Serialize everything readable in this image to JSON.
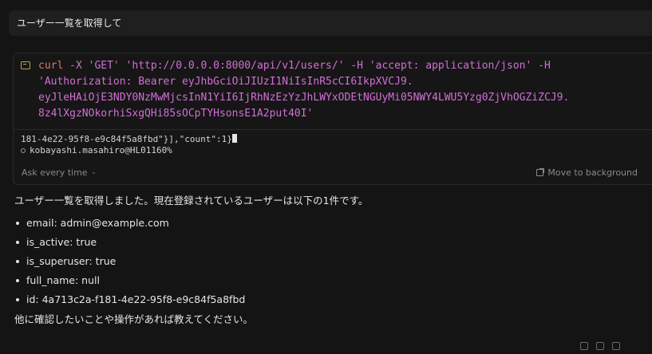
{
  "user_message": "ユーザー一覧を取得して",
  "tool": {
    "command_lines": [
      {
        "cmd": "curl",
        "rest": " -X 'GET' 'http://0.0.0.0:8000/api/v1/users/' -H 'accept: application/json' -H"
      },
      {
        "cmd": "",
        "rest": "'Authorization: Bearer eyJhbGciOiJIUzI1NiIsInR5cCI6IkpXVCJ9."
      },
      {
        "cmd": "",
        "rest": "eyJleHAiOjE3NDY0NzMwMjcsInN1YiI6IjRhNzEzYzJhLWYxODEtNGUyMi05NWY4LWU5Yzg0ZjVhOGZiZCJ9."
      },
      {
        "cmd": "",
        "rest": "8z4lXgzNOkorhiSxgQHi85sOCpTYHsonsE1A2put40I'"
      }
    ],
    "output_line": "181-4e22-95f8-e9c84f5a8fbd\"}],\"count\":1}",
    "prompt_line": "kobayashi.masahiro@HL01160%",
    "ask_label": "Ask every time",
    "background_label": "Move to background"
  },
  "answer": {
    "intro": "ユーザー一覧を取得しました。現在登録されているユーザーは以下の1件です。",
    "items": [
      "email: admin@example.com",
      "is_active: true",
      "is_superuser: true",
      "full_name: null",
      "id: 4a713c2a-f181-4e22-95f8-e9c84f5a8fbd"
    ],
    "closing": "他に確認したいことや操作があれば教えてください。"
  },
  "icons": {
    "terminal": "terminal-icon",
    "chevron": "chevron-down-icon",
    "background": "external-icon",
    "thumbs_up": "thumbs-up-icon",
    "thumbs_down": "thumbs-down-icon",
    "copy": "copy-icon"
  }
}
